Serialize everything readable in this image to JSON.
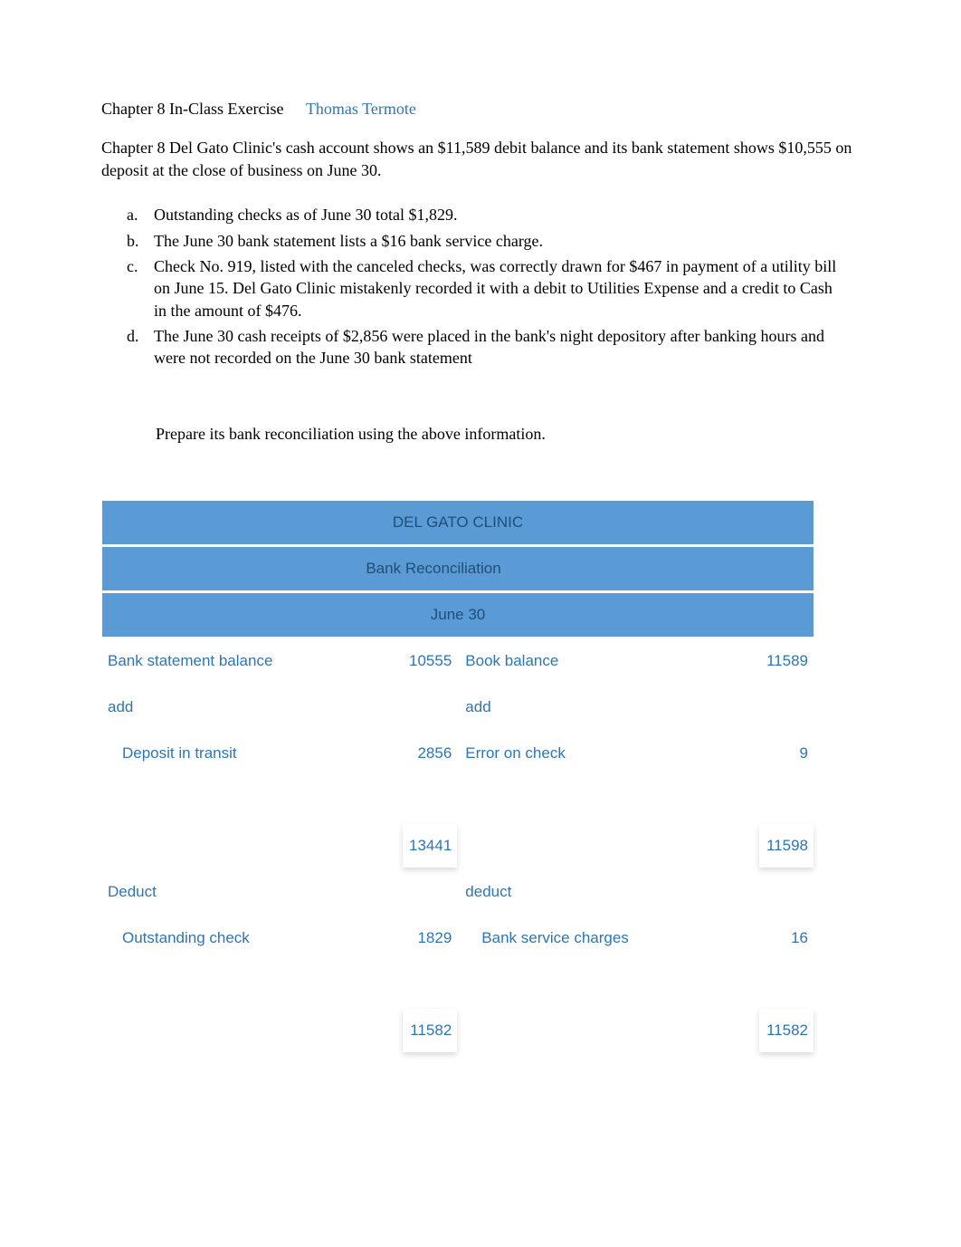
{
  "header": {
    "title": "Chapter 8 In-Class Exercise",
    "author": "Thomas Termote"
  },
  "intro": "Chapter 8 Del Gato Clinic's cash account shows an $11,589 debit balance and its bank statement shows $10,555 on deposit at the close of business on June 30.",
  "list": [
    {
      "marker": "a.",
      "text": "Outstanding checks as of June 30 total $1,829."
    },
    {
      "marker": "b.",
      "text": "The June 30 bank statement lists a $16 bank service charge."
    },
    {
      "marker": "c.",
      "text": "Check No. 919, listed with the canceled checks, was correctly drawn for $467 in payment of a utility bill on June 15. Del Gato Clinic mistakenly recorded it with a debit to Utilities Expense and a credit to Cash in the amount of $476."
    },
    {
      "marker": "d.",
      "text": "The June 30 cash receipts of $2,856 were placed in the bank's night depository after banking hours and were not recorded on the June 30 bank statement"
    }
  ],
  "instruction": "Prepare its bank reconciliation using the above information.",
  "table": {
    "company": "DEL GATO CLINIC",
    "title": "Bank Reconciliation",
    "date": "June 30",
    "bank_label": "Bank statement balance",
    "bank_value": "10555",
    "book_label": "Book balance",
    "book_value": "11589",
    "add_left": "add",
    "add_right": "add",
    "deposit_label": "Deposit in transit",
    "deposit_value": "2856",
    "error_label": "Error on check",
    "error_value": "9",
    "subtotal_left": "13441",
    "subtotal_right": "11598",
    "deduct_left": "Deduct",
    "deduct_right": "deduct",
    "outstanding_label": "Outstanding check",
    "outstanding_value": "1829",
    "service_label": "Bank service charges",
    "service_value": "16",
    "total_left": "11582",
    "total_right": "11582"
  }
}
